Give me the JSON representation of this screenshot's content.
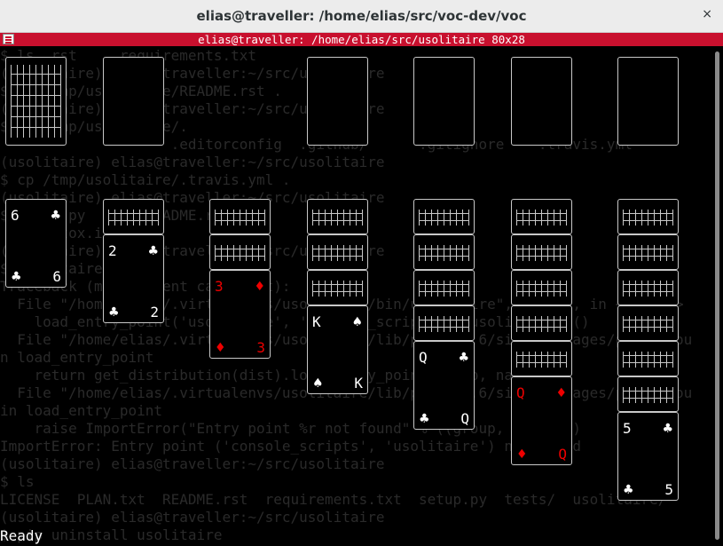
{
  "window": {
    "title": "elias@traveller: /home/elias/src/voc-dev/voc",
    "close_glyph": "×"
  },
  "terminal": {
    "title": "elias@traveller: /home/elias/src/usolitaire 80x28"
  },
  "background_lines": [
    "$ ls  rst     requirements.txt",
    "(usolitaire) elias@traveller:~/src/usolitaire",
    "$ cp /tmp/usolitaire/README.rst .",
    "(usolitaire) elias@traveller:~/src/usolitaire",
    "$ cp /tmp/usolitaire/.",
    "                    .editorconfig  .github/      .gitignore    .travis.yml",
    "(usolitaire) elias@traveller:~/src/usolitaire",
    "$ cp /tmp/usolitaire/.travis.yml .",
    "(usolitaire) elias@traveller:~/src/usolitaire",
    "$ setup.py       README.rst",
    "  File tox.ini",
    "(usolitaire) elias@traveller:~/src/usolitaire",
    "$ usolitaire",
    "Traceback (most recent call last):",
    "  File \"/home/elias/.virtualenvs/usolitaire/bin/usolitaire\", line 9, in <module>",
    "    load_entry_point('usolitaire', 'console_scripts', 'usolitaire')()",
    "  File \"/home/elias/.virtualenvs/usolitaire/lib/python3.6/site-packages/pkg_resou",
    "n load_entry_point",
    "    return get_distribution(dist).load_entry_point(group, name)",
    "  File \"/home/elias/.virtualenvs/usolitaire/lib/python3.6/site-packages/pkg_resou",
    "in load_entry_point",
    "    raise ImportError(\"Entry point %r not found\" % ((group, name),))",
    "ImportError: Entry point ('console_scripts', 'usolitaire') not found",
    "(usolitaire) elias@traveller:~/src/usolitaire",
    "$ ls",
    "LICENSE  PLAN.txt  README.rst  requirements.txt  setup.py  tests/  usolitaire/",
    "(usolitaire) elias@traveller:~/src/usolitaire",
    "$ pip uninstall usolitaire"
  ],
  "game": {
    "status": "Ready",
    "stock": {
      "face": "down"
    },
    "waste": {
      "face": "empty"
    },
    "foundations": [
      {
        "face": "empty"
      },
      {
        "face": "empty"
      },
      {
        "face": "empty"
      },
      {
        "face": "empty"
      }
    ],
    "tableau": [
      {
        "down": 0,
        "up": [
          {
            "rank": "6",
            "suit": "♣",
            "color": "black"
          }
        ]
      },
      {
        "down": 1,
        "up": [
          {
            "rank": "2",
            "suit": "♣",
            "color": "black"
          }
        ]
      },
      {
        "down": 2,
        "up": [
          {
            "rank": "3",
            "suit": "♦",
            "color": "red"
          }
        ]
      },
      {
        "down": 3,
        "up": [
          {
            "rank": "K",
            "suit": "♠",
            "color": "black"
          }
        ]
      },
      {
        "down": 4,
        "up": [
          {
            "rank": "Q",
            "suit": "♣",
            "color": "black"
          }
        ]
      },
      {
        "down": 5,
        "up": [
          {
            "rank": "Q",
            "suit": "♦",
            "color": "red"
          }
        ]
      },
      {
        "down": 6,
        "up": [
          {
            "rank": "5",
            "suit": "♣",
            "color": "black"
          }
        ]
      }
    ]
  },
  "colors": {
    "titlebar_red": "#c8102e",
    "card_border": "#c8c8c8",
    "red_suit": "#ee0000",
    "background": "#000000"
  }
}
